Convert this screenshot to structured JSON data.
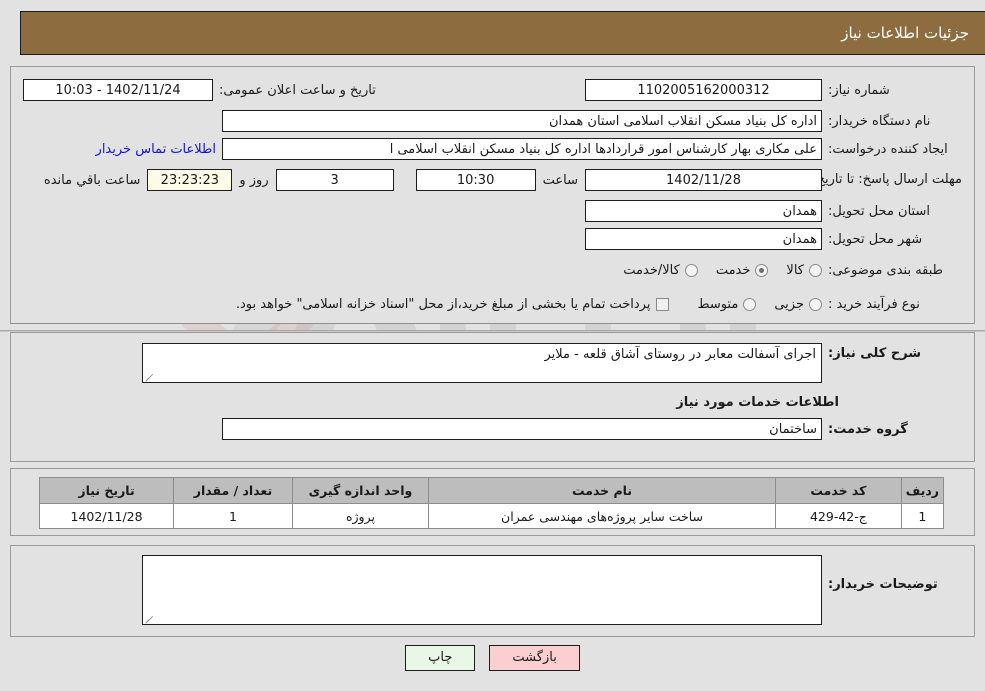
{
  "header": {
    "title": "جزئیات اطلاعات نیاز"
  },
  "form": {
    "need_number_label": "شماره نیاز:",
    "need_number_value": "1102005162000312",
    "announce_datetime_label": "تاریخ و ساعت اعلان عمومی:",
    "announce_datetime_value": "1402/11/24 - 10:03",
    "buyer_org_label": "نام دستگاه خریدار:",
    "buyer_org_value": "اداره کل بنیاد مسکن انقلاب اسلامی استان همدان",
    "creator_label": "ایجاد کننده درخواست:",
    "creator_value": "علی مکاری بهار کارشناس امور قراردادها اداره کل بنیاد مسکن انقلاب اسلامی ا",
    "buyer_contact_link": "اطلاعات تماس خریدار",
    "deadline_label": "مهلت ارسال پاسخ: تا تاریخ:",
    "deadline_date": "1402/11/28",
    "deadline_hour_label": "ساعت",
    "deadline_hour": "10:30",
    "remaining_days": "3",
    "remaining_days_label": "روز و",
    "remaining_countdown": "23:23:23",
    "remaining_suffix_label": "ساعت باقي مانده",
    "province_label": "استان محل تحویل:",
    "province_value": "همدان",
    "city_label": "شهر محل تحویل:",
    "city_value": "همدان",
    "category_label": "طبقه بندی موضوعی:",
    "category_options": [
      {
        "label": "کالا",
        "selected": false
      },
      {
        "label": "خدمت",
        "selected": true
      },
      {
        "label": "کالا/خدمت",
        "selected": false
      }
    ],
    "purchase_type_label": "نوع فرآیند خرید :",
    "purchase_type_options": [
      {
        "label": "جزیی",
        "selected": false
      },
      {
        "label": "متوسط",
        "selected": false
      }
    ],
    "treasury_checkbox_label": "پرداخت تمام یا بخشی از مبلغ خرید،از محل \"اسناد خزانه اسلامی\" خواهد بود.",
    "treasury_checked": false
  },
  "description": {
    "label": "شرح کلی نیاز:",
    "value": "اجرای آسفالت معابر در روستای آشاق قلعه - ملایر"
  },
  "service_section": {
    "title": "اطلاعات خدمات مورد نیاز",
    "group_label": "گروه خدمت:",
    "group_value": "ساختمان"
  },
  "table": {
    "columns": [
      "ردیف",
      "کد خدمت",
      "نام خدمت",
      "واحد اندازه گیری",
      "تعداد / مقدار",
      "تاریخ نیاز"
    ],
    "rows": [
      {
        "radif": "1",
        "code": "ج-42-429",
        "name": "ساخت سایر پروژه‌های مهندسی عمران",
        "unit": "پروژه",
        "qty": "1",
        "date": "1402/11/28"
      }
    ]
  },
  "comments": {
    "label": "توضیحات خریدار:",
    "value": ""
  },
  "footer": {
    "back_label": "بازگشت",
    "print_label": "چاپ"
  },
  "colors": {
    "header_bg": "#8d6d3f",
    "page_bg": "#e2e2e2",
    "link": "#1414d8",
    "table_header_bg": "#bdbdbd",
    "back_btn_bg": "#fbcfcf",
    "print_btn_bg": "#e9f7e6",
    "countdown_bg": "#fcfbe8"
  }
}
